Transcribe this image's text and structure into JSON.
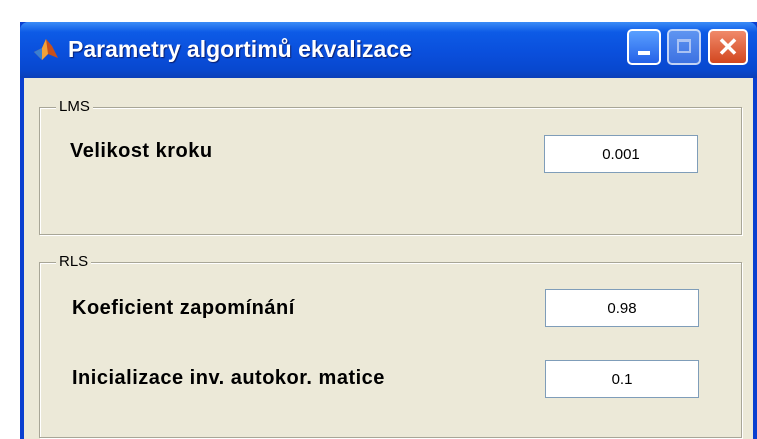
{
  "window": {
    "title": "Parametry algortimů ekvalizace",
    "controls": {
      "minimize": "minimize",
      "maximize": "maximize",
      "close": "✕"
    }
  },
  "lms": {
    "legend": "LMS",
    "step_label": "Velikost kroku",
    "step_value": "0.001"
  },
  "rls": {
    "legend": "RLS",
    "forgetting_label": "Koeficient zapomínání",
    "forgetting_value": "0.98",
    "init_label": "Inicializace inv. autokor. matice",
    "init_value": "0.1"
  },
  "colors": {
    "titlebar": "#0a4fdc",
    "client_background": "#ece9d8",
    "close_button": "#d2461f"
  },
  "icons": {
    "app": "matlab-logo-icon",
    "minimize": "minimize-icon",
    "maximize": "maximize-icon",
    "close": "close-icon"
  }
}
